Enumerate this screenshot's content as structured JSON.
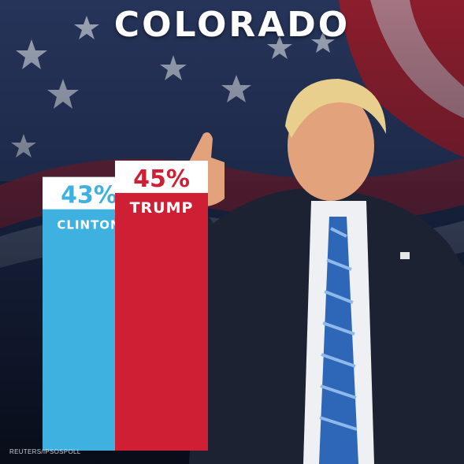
{
  "title": "COLORADO",
  "credit": "REUTERS/IPSOSPOLL",
  "colors": {
    "trump": "#cf1f34",
    "clinton": "#3fb1e0",
    "label_box": "#ffffff",
    "background": "#1b2540"
  },
  "chart_data": {
    "type": "bar",
    "title": "COLORADO",
    "categories": [
      "CLINTON",
      "TRUMP"
    ],
    "values": [
      43,
      45
    ],
    "value_labels": [
      "43%",
      "45%"
    ],
    "colors": [
      "#3fb1e0",
      "#cf1f34"
    ],
    "source": "REUTERS/IPSOSPOLL"
  }
}
